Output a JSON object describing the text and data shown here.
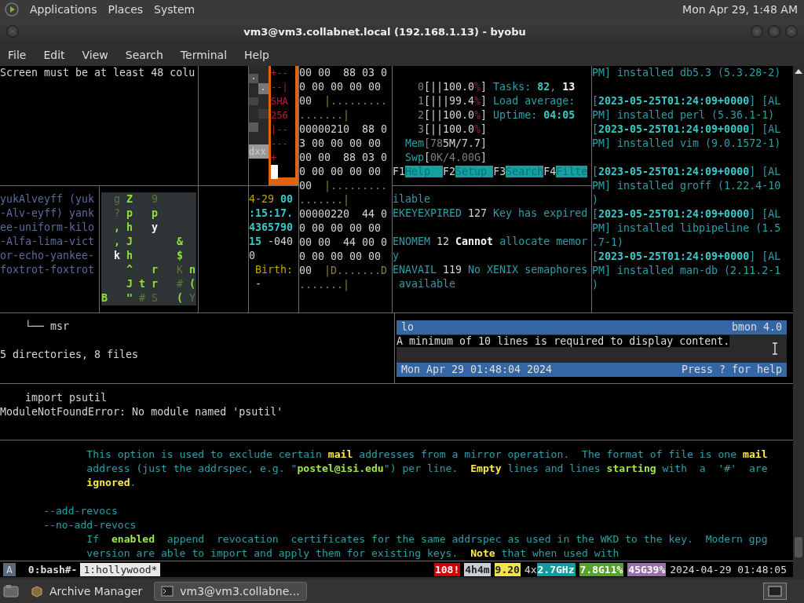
{
  "top_panel": {
    "menus": [
      "Applications",
      "Places",
      "System"
    ],
    "clock": "Mon Apr 29, 1:48 AM"
  },
  "window": {
    "title": "vm3@vm3.collabnet.local (192.168.1.13) - byobu"
  },
  "menu_bar": [
    "File",
    "Edit",
    "View",
    "Search",
    "Terminal",
    "Help"
  ],
  "panes": {
    "screen_warning": [
      {
        "spans": [
          {
            "text": "Screen must be at least 48 colu",
            "kind": "plain"
          }
        ]
      }
    ],
    "block_art": {
      "label": "dxx",
      "frame_lines": [
        "+--",
        "--|",
        "SHA",
        "256",
        "|--",
        "---",
        "+"
      ]
    },
    "hex_dump": [
      {
        "spans": [
          {
            "text": "00 00  88 03 0",
            "kind": "plain"
          }
        ]
      },
      {
        "spans": [
          {
            "text": "0 00 00 00 00",
            "kind": "plain"
          }
        ]
      },
      {
        "spans": [
          {
            "text": "00  ",
            "kind": "plain"
          },
          {
            "text": "|.........",
            "kind": "dim-yellow"
          }
        ]
      },
      {
        "spans": [
          {
            "text": ".......|",
            "kind": "dim-yellow"
          }
        ]
      },
      {
        "spans": [
          {
            "text": "00000210  88 0",
            "kind": "plain"
          }
        ]
      },
      {
        "spans": [
          {
            "text": "3 00 00 00 00",
            "kind": "plain"
          }
        ]
      },
      {
        "spans": [
          {
            "text": "00 00  88 03 0",
            "kind": "plain"
          }
        ]
      },
      {
        "spans": [
          {
            "text": "0 00 00 00 00",
            "kind": "plain"
          }
        ]
      },
      {
        "spans": [
          {
            "text": "00  ",
            "kind": "plain"
          },
          {
            "text": "|.........",
            "kind": "dim-yellow"
          }
        ]
      },
      {
        "spans": [
          {
            "text": ".......|",
            "kind": "dim-yellow"
          }
        ]
      },
      {
        "spans": [
          {
            "text": "00000220  44 0",
            "kind": "plain"
          }
        ]
      },
      {
        "spans": [
          {
            "text": "0 00 00 00 00",
            "kind": "plain"
          }
        ]
      },
      {
        "spans": [
          {
            "text": "00 00  44 00 0",
            "kind": "plain"
          }
        ]
      },
      {
        "spans": [
          {
            "text": "0 00 00 00 00",
            "kind": "plain"
          }
        ]
      },
      {
        "spans": [
          {
            "text": "00  ",
            "kind": "plain"
          },
          {
            "text": "|D.......D",
            "kind": "dim-yellow"
          }
        ]
      },
      {
        "spans": [
          {
            "text": ".......|",
            "kind": "dim-yellow"
          }
        ]
      }
    ],
    "htop": [
      {
        "blank": true
      },
      {
        "spans": [
          {
            "text": "    0",
            "kind": "dim"
          },
          {
            "text": "[||100.0",
            "kind": "plain"
          },
          {
            "text": "%",
            "kind": "red"
          },
          {
            "text": "] ",
            "kind": "plain"
          },
          {
            "text": "Tasks: ",
            "kind": "teal"
          },
          {
            "text": "82",
            "kind": "cyan-bold"
          },
          {
            "text": ", ",
            "kind": "teal"
          },
          {
            "text": "13",
            "kind": "bold"
          }
        ]
      },
      {
        "spans": [
          {
            "text": "    1",
            "kind": "dim"
          },
          {
            "text": "[|||99.4",
            "kind": "plain"
          },
          {
            "text": "%",
            "kind": "red"
          },
          {
            "text": "] ",
            "kind": "plain"
          },
          {
            "text": "Load average:",
            "kind": "teal"
          }
        ]
      },
      {
        "spans": [
          {
            "text": "    2",
            "kind": "dim"
          },
          {
            "text": "[||100.0",
            "kind": "plain"
          },
          {
            "text": "%",
            "kind": "red"
          },
          {
            "text": "] ",
            "kind": "plain"
          },
          {
            "text": "Uptime: ",
            "kind": "teal"
          },
          {
            "text": "04:05",
            "kind": "cyan-bold"
          }
        ]
      },
      {
        "spans": [
          {
            "text": "    3",
            "kind": "dim"
          },
          {
            "text": "[||100.0",
            "kind": "plain"
          },
          {
            "text": "%",
            "kind": "red"
          },
          {
            "text": "]",
            "kind": "plain"
          }
        ]
      },
      {
        "spans": [
          {
            "text": "  Mem",
            "kind": "teal"
          },
          {
            "text": "[78",
            "kind": "dim"
          },
          {
            "text": "5M/7.7]",
            "kind": "plain"
          }
        ]
      },
      {
        "spans": [
          {
            "text": "  Swp",
            "kind": "teal"
          },
          {
            "text": "[",
            "kind": "plain"
          },
          {
            "text": "0K/4.00G",
            "kind": "dim"
          },
          {
            "text": "]",
            "kind": "plain"
          }
        ]
      },
      {
        "spans": [
          {
            "text": "F1",
            "kind": "plain"
          },
          {
            "text": "Help  ",
            "kind": "key"
          },
          {
            "text": "F2",
            "kind": "plain"
          },
          {
            "text": "Setup ",
            "kind": "key"
          },
          {
            "text": "F3",
            "kind": "plain"
          },
          {
            "text": "Search",
            "kind": "key"
          },
          {
            "text": "F4",
            "kind": "plain"
          },
          {
            "text": "Filte",
            "kind": "key"
          }
        ]
      }
    ],
    "pacman_log": [
      {
        "spans": [
          {
            "text": "PM] installed db5.3 (5.3.28-2)",
            "kind": "teal"
          }
        ]
      },
      {
        "blank": true
      },
      {
        "spans": [
          {
            "text": "[",
            "kind": "teal"
          },
          {
            "text": "2023-05-25T01:24:09+0000",
            "kind": "cyan-bold"
          },
          {
            "text": "] [AL",
            "kind": "teal"
          }
        ]
      },
      {
        "spans": [
          {
            "text": "PM] installed perl (5.36.1-1)",
            "kind": "teal"
          }
        ]
      },
      {
        "spans": [
          {
            "text": "[",
            "kind": "teal"
          },
          {
            "text": "2023-05-25T01:24:09+0000",
            "kind": "cyan-bold"
          },
          {
            "text": "] [AL",
            "kind": "teal"
          }
        ]
      },
      {
        "spans": [
          {
            "text": "PM] installed vim (9.0.1572-1)",
            "kind": "teal"
          }
        ]
      },
      {
        "blank": true
      },
      {
        "spans": [
          {
            "text": "[",
            "kind": "teal"
          },
          {
            "text": "2023-05-25T01:24:09+0000",
            "kind": "cyan-bold"
          },
          {
            "text": "] [AL",
            "kind": "teal"
          }
        ]
      },
      {
        "spans": [
          {
            "text": "PM] installed groff (1.22.4-10",
            "kind": "teal"
          }
        ]
      },
      {
        "spans": [
          {
            "text": ")",
            "kind": "teal"
          }
        ]
      },
      {
        "spans": [
          {
            "text": "[",
            "kind": "teal"
          },
          {
            "text": "2023-05-25T01:24:09+0000",
            "kind": "cyan-bold"
          },
          {
            "text": "] [AL",
            "kind": "teal"
          }
        ]
      },
      {
        "spans": [
          {
            "text": "PM] installed libpipeline (1.5",
            "kind": "teal"
          }
        ]
      },
      {
        "spans": [
          {
            "text": ".7-1)",
            "kind": "teal"
          }
        ]
      },
      {
        "spans": [
          {
            "text": "[",
            "kind": "teal"
          },
          {
            "text": "2023-05-25T01:24:09+0000",
            "kind": "cyan-bold"
          },
          {
            "text": "] [AL",
            "kind": "teal"
          }
        ]
      },
      {
        "spans": [
          {
            "text": "PM] installed man-db (2.11.2-1",
            "kind": "teal"
          }
        ]
      },
      {
        "spans": [
          {
            "text": ")",
            "kind": "teal"
          }
        ]
      }
    ],
    "phonetic": [
      {
        "spans": [
          {
            "text": "yukAlveyff (yuk",
            "kind": "blue"
          }
        ]
      },
      {
        "spans": [
          {
            "text": "-Alv-eyff) yank",
            "kind": "blue"
          }
        ]
      },
      {
        "spans": [
          {
            "text": "ee-uniform-kilo",
            "kind": "blue"
          }
        ]
      },
      {
        "spans": [
          {
            "text": "-Alfa-lima-vict",
            "kind": "blue"
          }
        ]
      },
      {
        "spans": [
          {
            "text": "or-echo-yankee-",
            "kind": "blue"
          }
        ]
      },
      {
        "spans": [
          {
            "text": "foxtrot-foxtrot",
            "kind": "blue"
          }
        ]
      }
    ],
    "matrix": [
      {
        "spans": [
          {
            "text": "  g ",
            "kind": "dim-green"
          },
          {
            "text": "Z   ",
            "kind": "green"
          },
          {
            "text": "9",
            "kind": "dim-green"
          }
        ]
      },
      {
        "spans": [
          {
            "text": "  ? ",
            "kind": "dim-green"
          },
          {
            "text": "p   p",
            "kind": "green"
          }
        ]
      },
      {
        "spans": [
          {
            "text": "  , h   ",
            "kind": "green"
          },
          {
            "text": "y",
            "kind": "bold"
          }
        ]
      },
      {
        "spans": [
          {
            "text": "  , J       &",
            "kind": "green"
          }
        ]
      },
      {
        "spans": [
          {
            "text": "  k ",
            "kind": "bold"
          },
          {
            "text": "h       $",
            "kind": "green"
          }
        ]
      },
      {
        "spans": [
          {
            "text": "    ^   r   ",
            "kind": "green"
          },
          {
            "text": "K ",
            "kind": "dim-green"
          },
          {
            "text": "n",
            "kind": "green"
          }
        ]
      },
      {
        "spans": [
          {
            "text": "    J t r   ",
            "kind": "green"
          },
          {
            "text": "# ",
            "kind": "dim-green"
          },
          {
            "text": "(",
            "kind": "green"
          }
        ]
      },
      {
        "spans": [
          {
            "text": "B   \" ",
            "kind": "green"
          },
          {
            "text": "# S   ",
            "kind": "dim-green"
          },
          {
            "text": "( ",
            "kind": "green"
          },
          {
            "text": "Y",
            "kind": "dim-green"
          }
        ]
      }
    ],
    "stat": [
      {
        "spans": [
          {
            "text": "4-29 ",
            "kind": "yellow"
          },
          {
            "text": "00",
            "kind": "cyan-bold"
          }
        ]
      },
      {
        "spans": [
          {
            "text": ":15:17.",
            "kind": "cyan-bold"
          }
        ]
      },
      {
        "spans": [
          {
            "text": "4365790",
            "kind": "cyan-bold"
          }
        ]
      },
      {
        "spans": [
          {
            "text": "15",
            "kind": "cyan-bold"
          },
          {
            "text": " -040",
            "kind": "plain"
          }
        ]
      },
      {
        "spans": [
          {
            "text": "0",
            "kind": "plain"
          }
        ]
      },
      {
        "spans": [
          {
            "text": " Birth:",
            "kind": "yellow"
          }
        ]
      },
      {
        "spans": [
          {
            "text": " -",
            "kind": "plain"
          }
        ]
      }
    ],
    "errno": [
      {
        "spans": [
          {
            "text": "ilable",
            "kind": "teal"
          }
        ]
      },
      {
        "spans": [
          {
            "text": "EKEYEXPIRED",
            "kind": "teal"
          },
          {
            "text": " 127 ",
            "kind": "plain"
          },
          {
            "text": "Key has expired",
            "kind": "teal"
          }
        ]
      },
      {
        "blank": true
      },
      {
        "spans": [
          {
            "text": "ENOMEM",
            "kind": "teal"
          },
          {
            "text": " 12 ",
            "kind": "plain"
          },
          {
            "text": "Cannot",
            "kind": "bold"
          },
          {
            "text": " allocate memor",
            "kind": "teal"
          }
        ]
      },
      {
        "spans": [
          {
            "text": "y",
            "kind": "teal"
          }
        ]
      },
      {
        "spans": [
          {
            "text": "ENAVAIL",
            "kind": "teal"
          },
          {
            "text": " 119 ",
            "kind": "plain"
          },
          {
            "text": "No XENIX semaphores",
            "kind": "teal"
          }
        ]
      },
      {
        "spans": [
          {
            "text": " available",
            "kind": "teal"
          }
        ]
      }
    ],
    "tree": [
      {
        "spans": [
          {
            "text": "    └── msr",
            "kind": "plain"
          }
        ]
      },
      {
        "blank": true
      },
      {
        "spans": [
          {
            "text": "5 directories, 8 files",
            "kind": "plain"
          }
        ]
      }
    ],
    "bmon": {
      "interface": "lo",
      "version": "bmon 4.0",
      "message": "A minimum of 10 lines is required to display content.",
      "timestamp": "Mon Apr 29 01:48:04 2024",
      "help": "Press ? for help"
    },
    "python": [
      {
        "spans": [
          {
            "text": "    import psutil",
            "kind": "plain"
          }
        ]
      },
      {
        "spans": [
          {
            "text": "ModuleNotFoundError: No module named 'psutil'",
            "kind": "plain"
          }
        ]
      }
    ],
    "man_page": [
      {
        "spans": [
          {
            "text": "              This option is used to exclude certain ",
            "kind": "teal"
          },
          {
            "text": "mail",
            "kind": "yellow-bold"
          },
          {
            "text": " addresses from a mirror operation.  The format of file is one ",
            "kind": "teal"
          },
          {
            "text": "mail",
            "kind": "yellow-bold"
          }
        ]
      },
      {
        "spans": [
          {
            "text": "              address (just the addrspec, e.g. \"",
            "kind": "teal"
          },
          {
            "text": "postel@isi.edu",
            "kind": "green-bold"
          },
          {
            "text": "\") per line.  ",
            "kind": "teal"
          },
          {
            "text": "Empty",
            "kind": "yellow-bold"
          },
          {
            "text": " lines and lines ",
            "kind": "teal"
          },
          {
            "text": "starting",
            "kind": "green-bold"
          },
          {
            "text": " with  a  '#'  are",
            "kind": "teal"
          }
        ]
      },
      {
        "spans": [
          {
            "text": "              ignored",
            "kind": "yellow-bold"
          },
          {
            "text": ".",
            "kind": "teal"
          }
        ]
      },
      {
        "blank": true
      },
      {
        "spans": [
          {
            "text": "       --add-revocs",
            "kind": "teal"
          }
        ]
      },
      {
        "spans": [
          {
            "text": "       --no-add-revocs",
            "kind": "teal"
          }
        ]
      },
      {
        "spans": [
          {
            "text": "              If  ",
            "kind": "teal"
          },
          {
            "text": "enabled",
            "kind": "green-bold"
          },
          {
            "text": "  append  revocation  certificates for the same addrspec as used in the WKD to the key.  Modern gpg",
            "kind": "teal"
          }
        ]
      },
      {
        "spans": [
          {
            "text": "              version are able to import and apply them for existing keys.  ",
            "kind": "teal"
          },
          {
            "text": "Note",
            "kind": "yellow-bold"
          },
          {
            "text": " that when used with",
            "kind": "teal"
          }
        ]
      }
    ]
  },
  "status_bar": {
    "session": "A",
    "windows": [
      {
        "label": "0:bash#-",
        "selected": false
      },
      {
        "label": "1:hollywood*",
        "selected": true
      }
    ],
    "items": [
      {
        "text": "108!",
        "color": "#cc0000"
      },
      {
        "text": "4h4m",
        "color": "#c8ced4"
      },
      {
        "text": "9.20",
        "color": "#f2e14c"
      },
      {
        "prefix": "4x",
        "text": "2.7GHz",
        "color": "#149a9a"
      },
      {
        "text": "7.8G11%",
        "color": "#5aa02c"
      },
      {
        "text": "45G39%",
        "color": "#9a6fa8"
      }
    ],
    "clock": "2024-04-29 01:48:05"
  },
  "taskbar": [
    {
      "label": "Archive Manager",
      "selected": false
    },
    {
      "label": "vm3@vm3.collabne...",
      "selected": true
    }
  ]
}
